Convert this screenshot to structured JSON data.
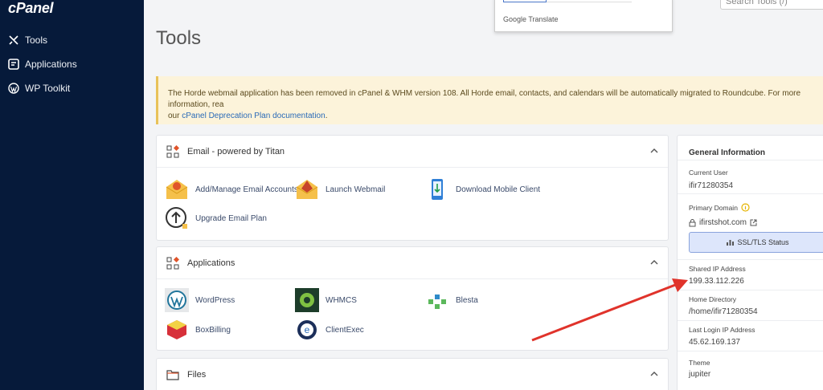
{
  "brand": {
    "logo_text": "cPanel"
  },
  "sidebar": {
    "items": [
      {
        "label": "Tools",
        "icon": "tools-icon"
      },
      {
        "label": "Applications",
        "icon": "applications-icon"
      },
      {
        "label": "WP Toolkit",
        "icon": "wordpress-icon"
      }
    ]
  },
  "search": {
    "placeholder": "Search Tools (/)"
  },
  "translate_popup": {
    "label": "Google Translate"
  },
  "page": {
    "title": "Tools"
  },
  "notice": {
    "text": "The Horde webmail application has been removed in cPanel & WHM version 108. All Horde email, contacts, and calendars will be automatically migrated to Roundcube. For more information, rea",
    "text2": "our ",
    "link": "cPanel Deprecation Plan documentation",
    "text3": "."
  },
  "email_panel": {
    "title": "Email - powered by Titan",
    "items": [
      {
        "label": "Add/Manage Email Accounts"
      },
      {
        "label": "Launch Webmail"
      },
      {
        "label": "Download Mobile Client"
      },
      {
        "label": "Upgrade Email Plan"
      }
    ]
  },
  "apps_panel": {
    "title": "Applications",
    "items": [
      {
        "label": "WordPress"
      },
      {
        "label": "WHMCS"
      },
      {
        "label": "Blesta"
      },
      {
        "label": "BoxBilling"
      },
      {
        "label": "ClientExec"
      }
    ]
  },
  "files_panel": {
    "title": "Files"
  },
  "general_info": {
    "title": "General Information",
    "current_user_label": "Current User",
    "current_user": "ifir71280354",
    "primary_domain_label": "Primary Domain",
    "primary_domain": "ifirstshot.com",
    "ssl_button": "SSL/TLS Status",
    "shared_ip_label": "Shared IP Address",
    "shared_ip": "199.33.112.226",
    "home_dir_label": "Home Directory",
    "home_dir": "/home/ifir71280354",
    "last_login_label": "Last Login IP Address",
    "last_login": "45.62.169.137",
    "theme_label": "Theme",
    "theme": "jupiter"
  },
  "colors": {
    "sidebar_bg": "#061a3a",
    "accent": "#2a6ab7",
    "notice_bg": "#fcf3da",
    "arrow": "#e0332b"
  }
}
